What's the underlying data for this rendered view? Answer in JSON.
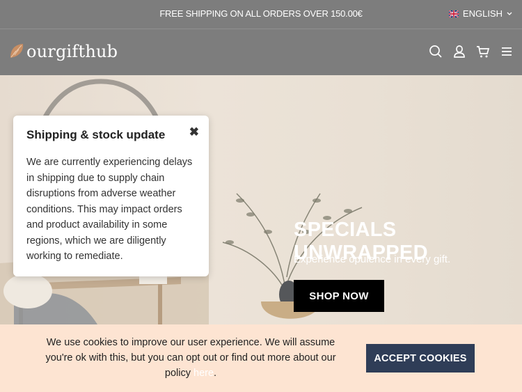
{
  "topbar": {
    "promo": "FREE SHIPPING ON ALL ORDERS OVER 150.00€",
    "language": "ENGLISH",
    "flag_icon": "uk-flag-icon"
  },
  "header": {
    "logo_text": "ourgifthub",
    "icons": [
      "search-icon",
      "user-icon",
      "cart-icon",
      "menu-icon"
    ]
  },
  "hero": {
    "title": "SPECIALS UNWRAPPED",
    "subtitle": "Experience opulence in every gift.",
    "cta_label": "SHOP NOW"
  },
  "popup": {
    "title": "Shipping & stock update",
    "close_symbol": "✖",
    "body": "We are currently experiencing delays in shipping due to supply chain disruptions from adverse weather conditions. This may impact orders and product availability in some regions, which we are diligently working to remediate."
  },
  "cookie": {
    "text": "We use cookies to improve our user experience. We will assume you're ok with this, but you can opt out or find out more about our policy",
    "link_label": "here",
    "suffix": ".",
    "accept_label": "ACCEPT COOKIES"
  },
  "colors": {
    "bar_bg": "#7d7d7d",
    "cookie_bg": "#fde4d2",
    "accept_bg": "#2f3d57",
    "shop_bg": "#000000"
  }
}
